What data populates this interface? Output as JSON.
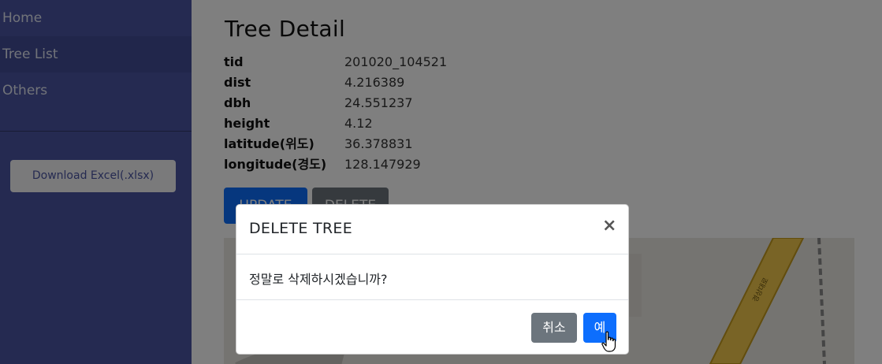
{
  "sidebar": {
    "items": [
      {
        "label": "Home"
      },
      {
        "label": "Tree List"
      },
      {
        "label": "Others"
      }
    ],
    "download_label": "Download Excel(.xlsx)"
  },
  "main": {
    "title": "Tree Detail",
    "fields": [
      {
        "label": "tid",
        "value": "201020_104521"
      },
      {
        "label": "dist",
        "value": "4.216389"
      },
      {
        "label": "dbh",
        "value": "24.551237"
      },
      {
        "label": "height",
        "value": "4.12"
      },
      {
        "label": "latitude(위도)",
        "value": "36.378831"
      },
      {
        "label": "longitude(경도)",
        "value": "128.147929"
      }
    ],
    "update_label": "UPDATE",
    "delete_label": "DELETE",
    "map": {
      "road_label": "경상대로"
    }
  },
  "modal": {
    "title": "DELETE TREE",
    "close_symbol": "×",
    "message": "정말로 삭제하시겠습니까?",
    "cancel_label": "취소",
    "confirm_label": "예"
  },
  "colors": {
    "sidebar_bg": "#4a55a2",
    "primary": "#0d6efd",
    "secondary": "#6c757d"
  }
}
